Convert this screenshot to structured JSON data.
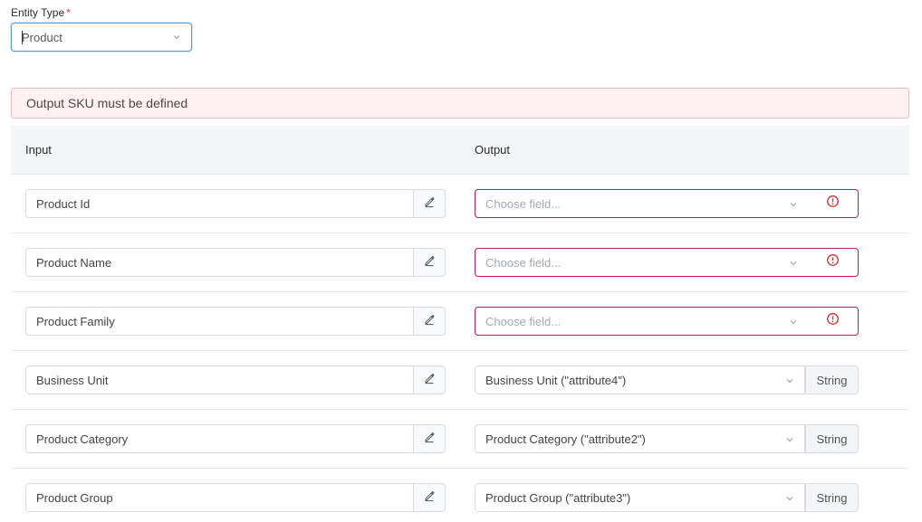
{
  "entity_type": {
    "label": "Entity Type",
    "required_mark": "*",
    "value": "Product"
  },
  "alert": {
    "message": "Output SKU must be defined"
  },
  "table": {
    "headers": {
      "input": "Input",
      "output": "Output"
    },
    "output_placeholder": "Choose field...",
    "rows": [
      {
        "input": "Product Id",
        "output": "",
        "type": "",
        "error": true
      },
      {
        "input": "Product Name",
        "output": "",
        "type": "",
        "error": true
      },
      {
        "input": "Product Family",
        "output": "",
        "type": "",
        "error": true
      },
      {
        "input": "Business Unit",
        "output": "Business Unit (\"attribute4\")",
        "type": "String",
        "error": false
      },
      {
        "input": "Product Category",
        "output": "Product Category (\"attribute2\")",
        "type": "String",
        "error": false
      },
      {
        "input": "Product Group",
        "output": "Product Group (\"attribute3\")",
        "type": "String",
        "error": false
      }
    ]
  },
  "colors": {
    "error": "#c2185b",
    "focus": "#5b9bd5",
    "alert_bg": "#fdf1f2",
    "header_bg": "#f4f5f6"
  },
  "icons": {
    "edit": "pencil-icon",
    "error": "info-circle-icon",
    "dropdown": "chevron-down-icon"
  }
}
